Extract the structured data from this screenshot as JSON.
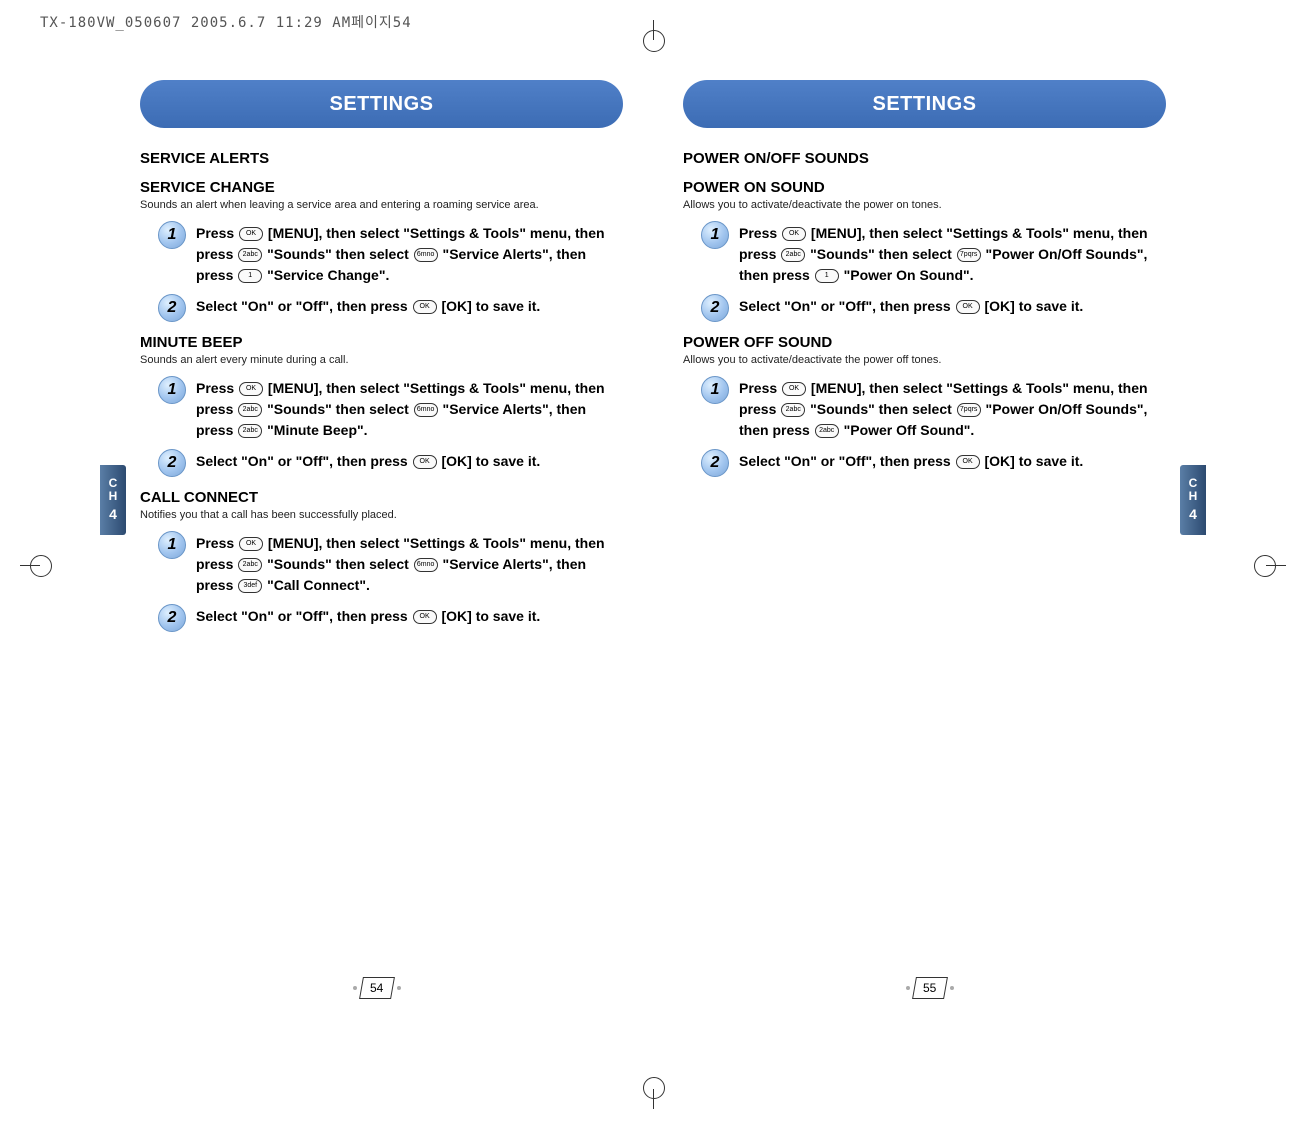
{
  "print_header": "TX-180VW_050607  2005.6.7 11:29 AM페이지54",
  "left": {
    "title": "SETTINGS",
    "page_num": "54",
    "sections": [
      {
        "heading": "SERVICE ALERTS",
        "subs": [
          {
            "sub_heading": "SERVICE CHANGE",
            "desc": "Sounds an alert when leaving a service area and entering a roaming service area.",
            "steps": [
              {
                "n": "1",
                "pre": "Press ",
                "k1": "OK",
                "mid1": " [MENU], then select \"Settings & Tools\" menu, then press ",
                "k2": "2abc",
                "mid2": " \"Sounds\" then select ",
                "k3": "6mno",
                "mid3": " \"Service Alerts\", then press ",
                "k4": "1",
                "tail": " \"Service Change\"."
              },
              {
                "n": "2",
                "pre": "Select \"On\" or \"Off\", then press ",
                "k1": "OK",
                "tail": " [OK] to save it."
              }
            ]
          },
          {
            "sub_heading": "MINUTE BEEP",
            "desc": "Sounds an alert every minute during a call.",
            "steps": [
              {
                "n": "1",
                "pre": "Press ",
                "k1": "OK",
                "mid1": " [MENU], then select \"Settings & Tools\" menu, then press ",
                "k2": "2abc",
                "mid2": " \"Sounds\" then select ",
                "k3": "6mno",
                "mid3": " \"Service Alerts\", then press ",
                "k4": "2abc",
                "tail": " \"Minute Beep\"."
              },
              {
                "n": "2",
                "pre": "Select \"On\" or \"Off\", then press ",
                "k1": "OK",
                "tail": " [OK] to save it."
              }
            ]
          },
          {
            "sub_heading": "CALL CONNECT",
            "desc": "Notifies you that a call has been successfully placed.",
            "steps": [
              {
                "n": "1",
                "pre": "Press ",
                "k1": "OK",
                "mid1": " [MENU], then select \"Settings & Tools\" menu, then press ",
                "k2": "2abc",
                "mid2": " \"Sounds\" then select ",
                "k3": "6mno",
                "mid3": " \"Service Alerts\", then press ",
                "k4": "3def",
                "tail": " \"Call Connect\"."
              },
              {
                "n": "2",
                "pre": "Select \"On\" or \"Off\", then press ",
                "k1": "OK",
                "tail": " [OK] to save it."
              }
            ]
          }
        ]
      }
    ],
    "tab": {
      "c": "C",
      "h": "H",
      "num": "4"
    }
  },
  "right": {
    "title": "SETTINGS",
    "page_num": "55",
    "sections": [
      {
        "heading": "POWER ON/OFF SOUNDS",
        "subs": [
          {
            "sub_heading": "POWER ON SOUND",
            "desc": "Allows you to activate/deactivate the power on tones.",
            "steps": [
              {
                "n": "1",
                "pre": "Press ",
                "k1": "OK",
                "mid1": " [MENU], then select \"Settings & Tools\" menu, then press ",
                "k2": "2abc",
                "mid2": " \"Sounds\" then select ",
                "k3": "7pqrs",
                "mid3": " \"Power On/Off Sounds\", then press ",
                "k4": "1",
                "tail": " \"Power On Sound\"."
              },
              {
                "n": "2",
                "pre": "Select \"On\" or \"Off\", then press ",
                "k1": "OK",
                "tail": " [OK] to save it."
              }
            ]
          },
          {
            "sub_heading": "POWER OFF SOUND",
            "desc": "Allows you to activate/deactivate the power off tones.",
            "steps": [
              {
                "n": "1",
                "pre": "Press ",
                "k1": "OK",
                "mid1": " [MENU], then select \"Settings & Tools\" menu, then press ",
                "k2": "2abc",
                "mid2": " \"Sounds\" then select ",
                "k3": "7pqrs",
                "mid3": " \"Power On/Off Sounds\", then press ",
                "k4": "2abc",
                "tail": " \"Power Off Sound\"."
              },
              {
                "n": "2",
                "pre": "Select \"On\" or \"Off\", then press ",
                "k1": "OK",
                "tail": " [OK] to save it."
              }
            ]
          }
        ]
      }
    ],
    "tab": {
      "c": "C",
      "h": "H",
      "num": "4"
    }
  }
}
